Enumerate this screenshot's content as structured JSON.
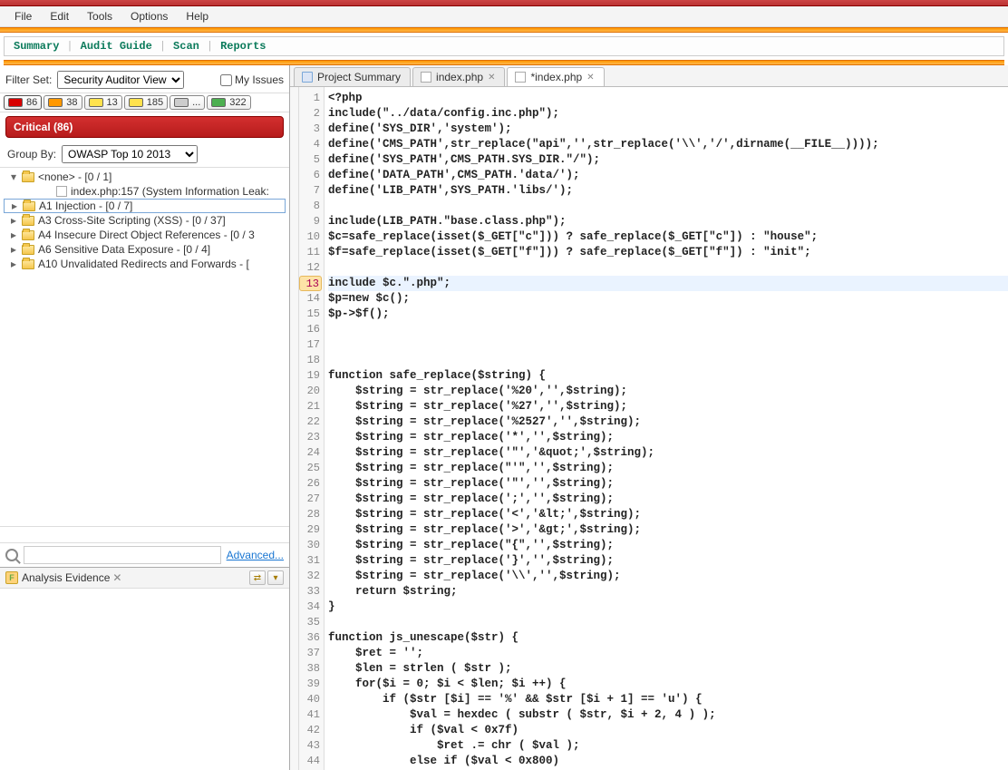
{
  "menu": {
    "file": "File",
    "edit": "Edit",
    "tools": "Tools",
    "options": "Options",
    "help": "Help"
  },
  "subnav": {
    "summary": "Summary",
    "audit": "Audit Guide",
    "scan": "Scan",
    "reports": "Reports"
  },
  "filter": {
    "label": "Filter Set:",
    "options": [
      "Security Auditor View"
    ],
    "selected": "Security Auditor View",
    "myissues": "My Issues"
  },
  "counts": [
    {
      "color": "red",
      "value": "86"
    },
    {
      "color": "orange",
      "value": "38"
    },
    {
      "color": "yellow",
      "value": "13"
    },
    {
      "color": "yellow2",
      "value": "185"
    },
    {
      "color": "gray",
      "value": "..."
    },
    {
      "color": "green",
      "value": "322"
    }
  ],
  "banner": "Critical (86)",
  "groupby": {
    "label": "Group By:",
    "options": [
      "OWASP Top 10 2013"
    ],
    "selected": "OWASP Top 10 2013"
  },
  "tree": [
    {
      "indent": 0,
      "expander": "▾",
      "icon": "folder",
      "label": "<none> - [0 / 1]"
    },
    {
      "indent": 2,
      "expander": "",
      "icon": "file",
      "label": "index.php:157 (System Information Leak:"
    },
    {
      "indent": 0,
      "expander": "▸",
      "icon": "folder",
      "label": "A1 Injection - [0 / 7]",
      "selected": true
    },
    {
      "indent": 0,
      "expander": "▸",
      "icon": "folder",
      "label": "A3 Cross-Site Scripting (XSS) - [0 / 37]"
    },
    {
      "indent": 0,
      "expander": "▸",
      "icon": "folder",
      "label": "A4 Insecure Direct Object References - [0 / 3"
    },
    {
      "indent": 0,
      "expander": "▸",
      "icon": "folder",
      "label": "A6 Sensitive Data Exposure - [0 / 4]"
    },
    {
      "indent": 0,
      "expander": "▸",
      "icon": "folder",
      "label": "A10 Unvalidated Redirects and Forwards - ["
    }
  ],
  "search": {
    "advanced": "Advanced..."
  },
  "evidence": {
    "title": "Analysis Evidence"
  },
  "tabs": [
    {
      "label": "Project Summary",
      "icon": "tabicon",
      "closable": false,
      "active": false
    },
    {
      "label": "index.php",
      "icon": "phpicon",
      "closable": true,
      "active": false
    },
    {
      "label": "*index.php",
      "icon": "phpicon",
      "closable": true,
      "active": true
    }
  ],
  "code": {
    "highlight_line": 13,
    "lines": [
      "<?php",
      "include(\"../data/config.inc.php\");",
      "define('SYS_DIR','system');",
      "define('CMS_PATH',str_replace(\"api\",'',str_replace('\\\\','/',dirname(__FILE__))));",
      "define('SYS_PATH',CMS_PATH.SYS_DIR.\"/\");",
      "define('DATA_PATH',CMS_PATH.'data/');",
      "define('LIB_PATH',SYS_PATH.'libs/');",
      "",
      "include(LIB_PATH.\"base.class.php\");",
      "$c=safe_replace(isset($_GET[\"c\"])) ? safe_replace($_GET[\"c\"]) : \"house\";",
      "$f=safe_replace(isset($_GET[\"f\"])) ? safe_replace($_GET[\"f\"]) : \"init\";",
      "",
      "include $c.\".php\";",
      "$p=new $c();",
      "$p->$f();",
      "",
      "",
      "",
      "function safe_replace($string) {",
      "    $string = str_replace('%20','',$string);",
      "    $string = str_replace('%27','',$string);",
      "    $string = str_replace('%2527','',$string);",
      "    $string = str_replace('*','',$string);",
      "    $string = str_replace('\"','&quot;',$string);",
      "    $string = str_replace(\"'\",'',$string);",
      "    $string = str_replace('\"','',$string);",
      "    $string = str_replace(';','',$string);",
      "    $string = str_replace('<','&lt;',$string);",
      "    $string = str_replace('>','&gt;',$string);",
      "    $string = str_replace(\"{\",'',$string);",
      "    $string = str_replace('}','',$string);",
      "    $string = str_replace('\\\\','',$string);",
      "    return $string;",
      "}",
      "",
      "function js_unescape($str) {",
      "    $ret = '';",
      "    $len = strlen ( $str );",
      "    for($i = 0; $i < $len; $i ++) {",
      "        if ($str [$i] == '%' && $str [$i + 1] == 'u') {",
      "            $val = hexdec ( substr ( $str, $i + 2, 4 ) );",
      "            if ($val < 0x7f)",
      "                $ret .= chr ( $val );",
      "            else if ($val < 0x800)"
    ]
  }
}
